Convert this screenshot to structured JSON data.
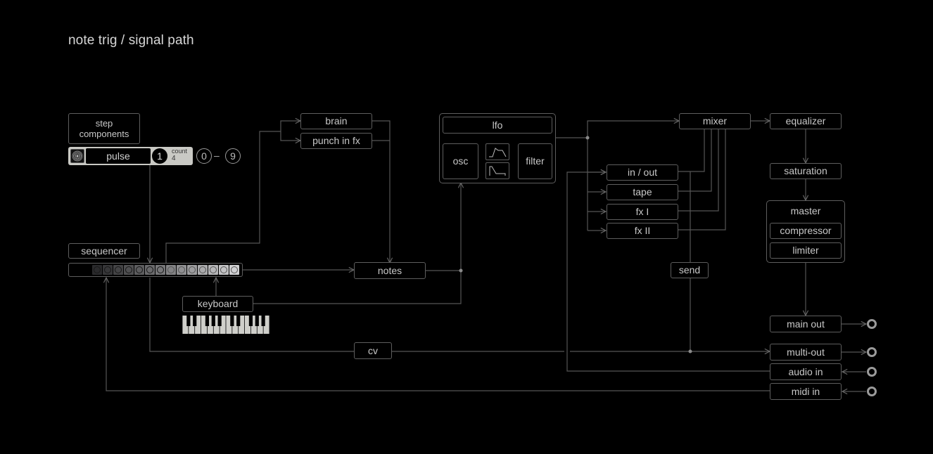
{
  "title": "note trig / signal path",
  "nodes": {
    "step_components": "step\ncomponents",
    "pulse": {
      "label": "pulse",
      "number": "1",
      "count_label": "count",
      "count_value": "4",
      "icon": "radial-pulse-icon"
    },
    "range": {
      "min": "0",
      "dash": "–",
      "max": "9"
    },
    "sequencer": "sequencer",
    "sequencer_steps": 14,
    "keyboard": "keyboard",
    "brain": "brain",
    "punch_in_fx": "punch in fx",
    "notes": "notes",
    "cv": "cv",
    "lfo": "lfo",
    "osc": "osc",
    "filter": "filter",
    "envelope_icons": [
      "adsr-envelope-icon",
      "decay-envelope-icon"
    ],
    "mixer": "mixer",
    "in_out": "in / out",
    "tape": "tape",
    "fx_1": "fx I",
    "fx_2": "fx II",
    "send": "send",
    "equalizer": "equalizer",
    "saturation": "saturation",
    "master": "master",
    "compressor": "compressor",
    "limiter": "limiter",
    "main_out": "main out",
    "multi_out": "multi-out",
    "audio_in": "audio in",
    "midi_in": "midi in"
  },
  "colors": {
    "background": "#000000",
    "wire": "#5a5a5a",
    "box_border": "#5e5e5e",
    "text": "#c8c8c8",
    "pulse_bar": "#c9c9c4"
  }
}
